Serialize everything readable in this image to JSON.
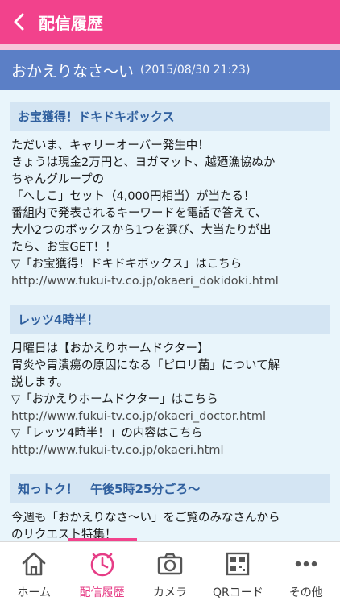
{
  "header": {
    "title": "配信履歴"
  },
  "banner": {
    "title": "おかえりなさ〜い",
    "date": "(2015/08/30 21:23)"
  },
  "sections": [
    {
      "heading": "お宝獲得！ドキドキボックス",
      "lines": [
        "ただいま、キャリーオーバー発生中！",
        "きょうは現金2万円と、ヨガマット、越廼漁協ぬか",
        "ちゃんグループの",
        "「へしこ」セット（4,000円相当）が当たる！",
        "番組内で発表されるキーワードを電話で答えて、",
        "大小2つのボックスから1つを選び、大当たりが出",
        "たら、お宝GET！！",
        "▽「お宝獲得！ドキドキボックス」はこちら",
        "http://www.fukui-tv.co.jp/okaeri_dokidoki.html"
      ]
    },
    {
      "heading": "レッツ4時半！",
      "lines": [
        "月曜日は【おかえりホームドクター】",
        "胃炎や胃潰瘍の原因になる「ピロリ菌」について解",
        "説します。",
        "▽「おかえりホームドクター」はこちら",
        "http://www.fukui-tv.co.jp/okaeri_doctor.html",
        "▽「レッツ4時半！」の内容はこちら",
        "http://www.fukui-tv.co.jp/okaeri.html"
      ]
    },
    {
      "heading": "知っトク！　午後5時25分ごろ〜",
      "lines": [
        "今週も「おかえりなさ〜い」をご覧のみなさんから",
        "のリクエスト特集！"
      ]
    }
  ],
  "tabs": [
    {
      "label": "ホーム",
      "icon": "home-icon"
    },
    {
      "label": "配信履歴",
      "icon": "clock-icon",
      "active": true
    },
    {
      "label": "カメラ",
      "icon": "camera-icon"
    },
    {
      "label": "QRコード",
      "icon": "qr-code-icon"
    },
    {
      "label": "その他",
      "icon": "more-icon"
    }
  ],
  "colors": {
    "header": "#f2428c",
    "banner": "#5b7fc6",
    "active": "#e63d86",
    "content_bg": "#e9f5fb"
  }
}
